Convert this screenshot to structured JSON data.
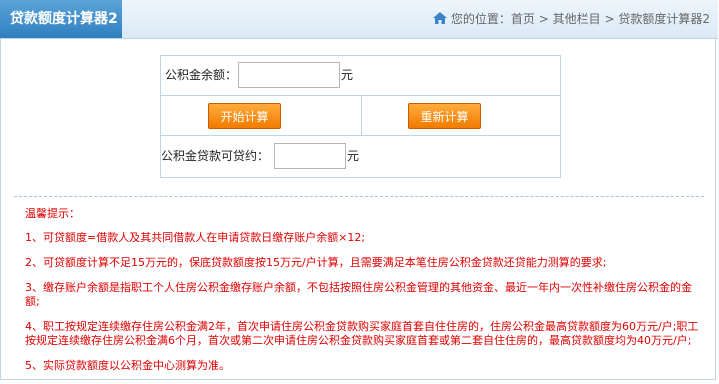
{
  "header": {
    "title": "贷款额度计算器2",
    "breadcrumb_prefix": "您的位置：",
    "crumbs": [
      "首页",
      "其他栏目",
      "贷款额度计算器2"
    ],
    "separator": ">"
  },
  "form": {
    "balance_label": "公积金余额：",
    "balance_value": "",
    "balance_unit": "元",
    "start_button": "开始计算",
    "reset_button": "重新计算",
    "result_label": "公积金贷款可贷约：",
    "result_value": "",
    "result_unit": "元"
  },
  "tips": {
    "heading": "温馨提示：",
    "items": [
      "1、可贷额度=借款人及其共同借款人在申请贷款日缴存账户余额×12;",
      "2、可贷额度计算不足15万元的，保底贷款额度按15万元/户计算，且需要满足本笔住房公积金贷款还贷能力测算的要求;",
      "3、缴存账户余额是指职工个人住房公积金缴存账户余额，不包括按照住房公积金管理的其他资金、最近一年内一次性补缴住房公积金的金额;",
      "4、职工按规定连续缴存住房公积金满2年，首次申请住房公积金贷款购买家庭首套自住住房的，住房公积金最高贷款额度为60万元/户;职工按规定连续缴存住房公积金满6个月，首次或第二次申请住房公积金贷款购买家庭首套或第二套自住住房的，最高贷款额度均为40万元/户;",
      "5、实际贷款额度以公积金中心测算为准。"
    ]
  },
  "colors": {
    "header_tab": "#2f7fc0",
    "button": "#f17b00",
    "tip_text": "#e00000",
    "border": "#b9d6ea"
  },
  "icons": {
    "breadcrumb_home": "home-icon"
  }
}
